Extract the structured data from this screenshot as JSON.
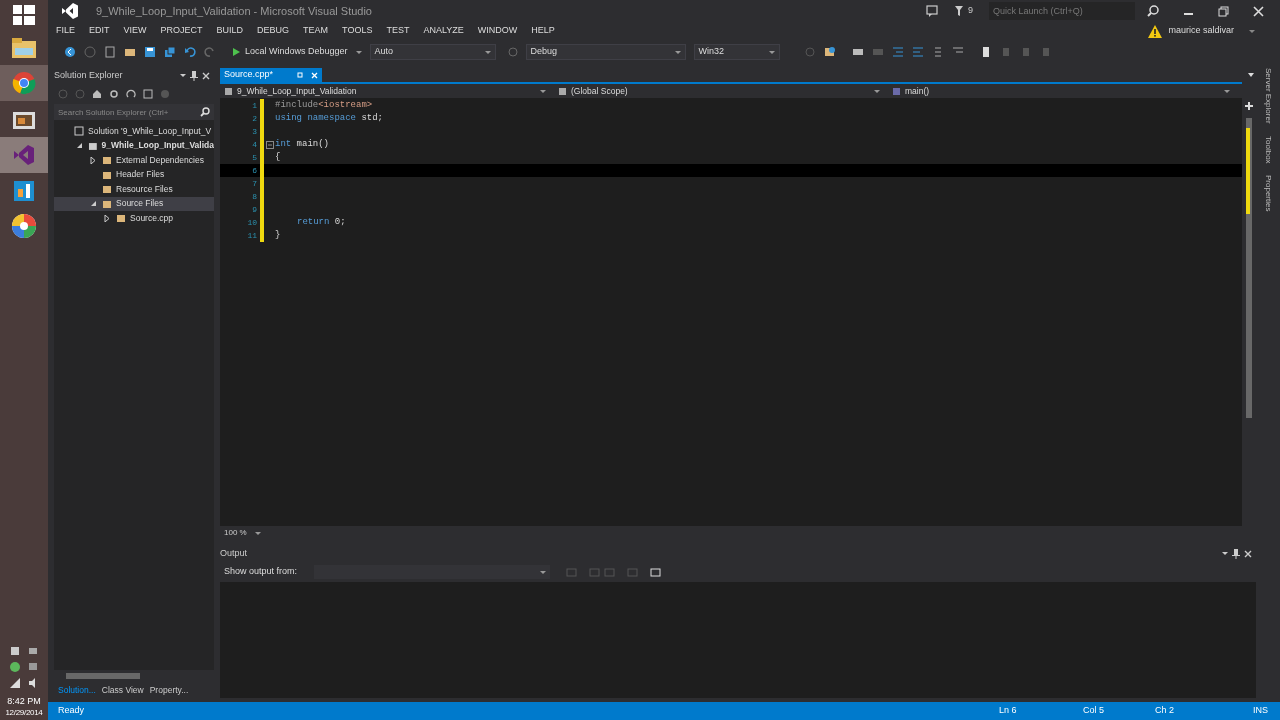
{
  "taskbar": {
    "time": "8:42 PM",
    "date": "12/29/2014"
  },
  "window": {
    "title": "9_While_Loop_Input_Validation - Microsoft Visual Studio",
    "notification_count": "9",
    "quick_launch": {
      "placeholder": "Quick Launch (Ctrl+Q)"
    },
    "account": "maurice saldivar"
  },
  "menu": [
    "FILE",
    "EDIT",
    "VIEW",
    "PROJECT",
    "BUILD",
    "DEBUG",
    "TEAM",
    "TOOLS",
    "TEST",
    "ANALYZE",
    "WINDOW",
    "HELP"
  ],
  "toolbar": {
    "run": "Local Windows Debugger",
    "dropdowns": [
      "Auto",
      "Debug",
      "Win32"
    ]
  },
  "solution_explorer": {
    "title": "Solution Explorer",
    "search": {
      "placeholder": "Search Solution Explorer (Ctrl+"
    },
    "tree": [
      {
        "label": "Solution '9_While_Loop_Input_V",
        "expandable": false,
        "selected": false,
        "bold": false,
        "children": [
          {
            "label": "9_While_Loop_Input_Valida",
            "expandable": true,
            "expanded": true,
            "selected": false,
            "bold": true,
            "children": [
              {
                "label": "External Dependencies",
                "expandable": true,
                "expanded": false,
                "selected": false,
                "bold": false
              },
              {
                "label": "Header Files",
                "expandable": false,
                "selected": false,
                "bold": false
              },
              {
                "label": "Resource Files",
                "expandable": false,
                "selected": false,
                "bold": false
              },
              {
                "label": "Source Files",
                "expandable": true,
                "expanded": true,
                "selected": true,
                "bold": false,
                "children": [
                  {
                    "label": "Source.cpp",
                    "expandable": true,
                    "expanded": false,
                    "selected": false,
                    "bold": false
                  }
                ]
              }
            ]
          }
        ]
      }
    ],
    "tabs": [
      {
        "label": "Solution...",
        "selected": true
      },
      {
        "label": "Class View",
        "selected": false
      },
      {
        "label": "Property...",
        "selected": false
      }
    ]
  },
  "editor": {
    "tabs": [
      {
        "label": "Source.cpp*",
        "selected": true
      }
    ],
    "nav": {
      "project": "9_While_Loop_Input_Validation",
      "scope": "(Global Scope)",
      "member": "main()"
    },
    "lines": [
      {
        "number": "1",
        "modified": true,
        "fold_start": false,
        "current": false,
        "indented": false,
        "tokens": [
          {
            "text": "#include",
            "kind": "directive"
          },
          {
            "text": "<iostream>",
            "kind": "string"
          }
        ]
      },
      {
        "number": "2",
        "modified": true,
        "fold_start": false,
        "current": false,
        "indented": false,
        "tokens": [
          {
            "text": "using namespace",
            "kind": "keyword"
          },
          {
            "text": " std;",
            "kind": "plain"
          }
        ]
      },
      {
        "number": "3",
        "modified": true,
        "fold_start": false,
        "current": false
      },
      {
        "number": "4",
        "modified": true,
        "fold_start": true,
        "current": false,
        "indented": false,
        "tokens": [
          {
            "text": "int",
            "kind": "keyword"
          },
          {
            "text": " main()",
            "kind": "plain"
          }
        ]
      },
      {
        "number": "5",
        "modified": true,
        "fold_start": false,
        "current": false,
        "indented": false,
        "tokens": [
          {
            "text": "{",
            "kind": "plain"
          }
        ]
      },
      {
        "number": "6",
        "modified": true,
        "fold_start": false,
        "current": true
      },
      {
        "number": "7",
        "modified": true,
        "fold_start": false,
        "current": false
      },
      {
        "number": "8",
        "modified": true,
        "fold_start": false,
        "current": false
      },
      {
        "number": "9",
        "modified": true,
        "fold_start": false,
        "current": false
      },
      {
        "number": "10",
        "modified": true,
        "fold_start": false,
        "current": false,
        "indented": true,
        "tokens": [
          {
            "text": "return",
            "kind": "keyword"
          },
          {
            "text": " 0;",
            "kind": "plain"
          }
        ]
      },
      {
        "number": "11",
        "modified": true,
        "fold_start": false,
        "current": false,
        "indented": false,
        "tokens": [
          {
            "text": "}",
            "kind": "plain"
          }
        ]
      }
    ],
    "zoom": "100 %"
  },
  "output": {
    "title": "Output",
    "show_from": "Show output from:"
  },
  "side_tabs": [
    "Server Explorer",
    "Toolbox",
    "Properties"
  ],
  "status_bar": {
    "message": "Ready",
    "line": "Ln 6",
    "column": "Col 5",
    "char": "Ch 2",
    "mode": "INS"
  }
}
